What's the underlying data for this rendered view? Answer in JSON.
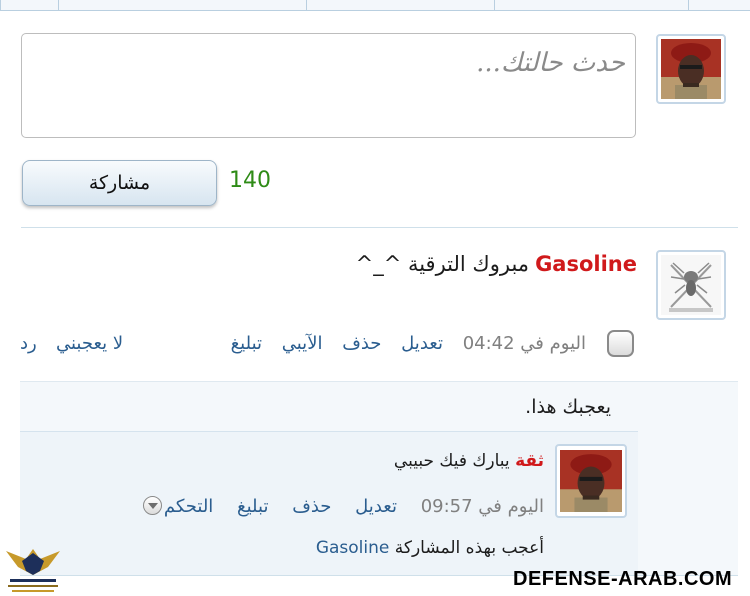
{
  "composer": {
    "placeholder": "حدث حالتك...",
    "char_count": "140",
    "share_label": "مشاركة"
  },
  "post": {
    "author": "Gasoline",
    "message": "مبروك الترقية ^_^",
    "time": "اليوم في 04:42",
    "actions": {
      "edit": "تعديل",
      "delete": "حذف",
      "ip": "الآيبي",
      "report": "تبليغ",
      "unlike": "لا يعجبني",
      "reply": "رد"
    },
    "like_text": "يعجبك هذا."
  },
  "comment": {
    "badge": "ثقة",
    "text": "يبارك فيك حبيبي",
    "time": "اليوم في 09:57",
    "actions": {
      "edit": "تعديل",
      "delete": "حذف",
      "report": "تبليغ",
      "control": "التحكم"
    },
    "liked_prefix": "أعجب بهذه المشاركة",
    "liked_user": "Gasoline"
  },
  "watermark": {
    "site": "DEFENSE-ARAB.COM"
  },
  "colors": {
    "author": "#d0191b",
    "link": "#2a5d8f",
    "count": "#2e8b16"
  }
}
